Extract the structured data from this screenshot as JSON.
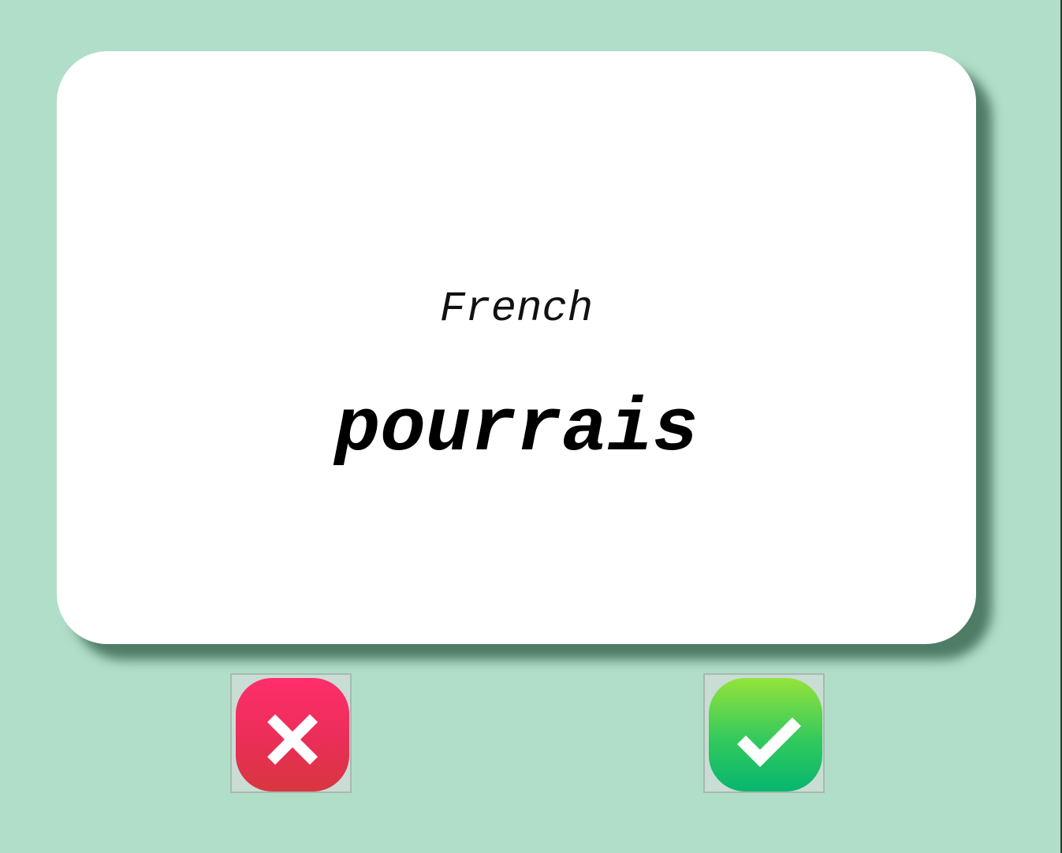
{
  "card": {
    "language": "French",
    "word": "pourrais"
  },
  "actions": {
    "wrong_icon": "close-icon",
    "correct_icon": "check-icon"
  },
  "colors": {
    "background": "#b1dec8",
    "card": "#ffffff",
    "wrong": "#ea2e58",
    "correct": "#32c95d"
  }
}
